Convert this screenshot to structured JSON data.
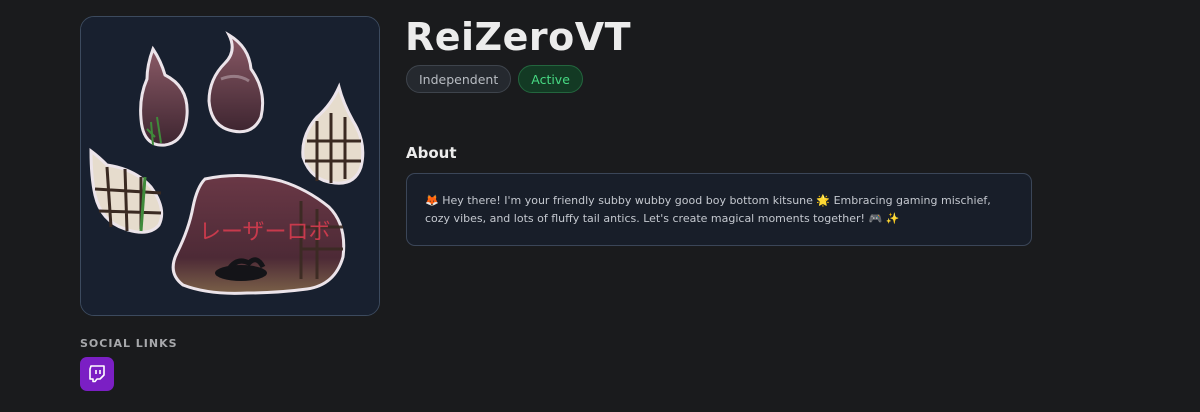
{
  "profile": {
    "name": "ReiZeroVT",
    "badges": {
      "affiliation": "Independent",
      "status": "Active"
    },
    "avatar": {
      "icon": "paw-print-avatar",
      "logo_text": "レーザーロボ",
      "colors": {
        "background": "#18202f",
        "paw_fill": "#5a3440",
        "paw_outline": "#e8e0e6"
      }
    }
  },
  "about": {
    "heading": "About",
    "bio": "🦊 Hey there! I'm your friendly subby wubby good boy bottom kitsune 🌟 Embracing gaming mischief, cozy vibes, and lots of fluffy tail antics. Let's create magical moments together! 🎮 ✨"
  },
  "social": {
    "heading": "SOCIAL LINKS",
    "links": [
      {
        "platform": "twitch",
        "icon": "twitch-icon",
        "color": "#7b1fc4"
      }
    ]
  },
  "colors": {
    "page_background": "#1a1b1d",
    "active_green": "#47d983",
    "twitch_purple": "#7b1fc4"
  }
}
